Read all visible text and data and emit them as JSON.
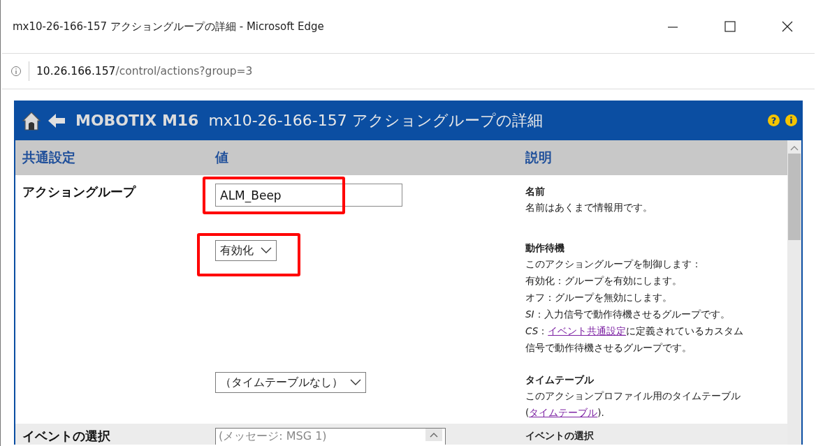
{
  "window": {
    "title": "mx10-26-166-157 アクショングループの詳細 - Microsoft Edge"
  },
  "address_bar": {
    "host": "10.26.166.157",
    "path": "/control/actions?group=3"
  },
  "header": {
    "brand": "MOBOTIX M16",
    "title": "mx10-26-166-157 アクショングループの詳細",
    "help": "?",
    "info": "i"
  },
  "columns": [
    "共通設定",
    "値",
    "説明"
  ],
  "sections": [
    {
      "label": "アクショングループ",
      "fields": [
        {
          "kind": "text",
          "value": "ALM_Beep",
          "highlighted": true,
          "description": {
            "title": "名前",
            "lines": [
              [
                {
                  "kind": "text",
                  "text": "名前はあくまで情報用です。"
                }
              ]
            ]
          }
        },
        {
          "kind": "select",
          "value": "有効化",
          "highlighted": true,
          "description": {
            "title": "動作待機",
            "lines": [
              [
                {
                  "kind": "text",
                  "text": "このアクショングループを制御します："
                }
              ],
              [
                {
                  "kind": "text",
                  "text": "有効化：グループを有効にします。"
                }
              ],
              [
                {
                  "kind": "text",
                  "text": "オフ：グループを無効にします。"
                }
              ],
              [
                {
                  "kind": "italic",
                  "text": "SI"
                },
                {
                  "kind": "text",
                  "text": "：入力信号で動作待機させるグループです。"
                }
              ],
              [
                {
                  "kind": "italic",
                  "text": "CS"
                },
                {
                  "kind": "text",
                  "text": "："
                },
                {
                  "kind": "link",
                  "text": "イベント共通設定"
                },
                {
                  "kind": "text",
                  "text": "に定義されているカスタム"
                }
              ],
              [
                {
                  "kind": "text",
                  "text": "信号で動作待機させるグループです。"
                }
              ]
            ]
          }
        },
        {
          "kind": "select",
          "value": "（タイムテーブルなし）",
          "description": {
            "title": "タイムテーブル",
            "lines": [
              [
                {
                  "kind": "text",
                  "text": "このアクションプロファイル用のタイムテーブル"
                }
              ],
              [
                {
                  "kind": "text",
                  "text": "("
                },
                {
                  "kind": "link",
                  "text": "タイムテーブル"
                },
                {
                  "kind": "text",
                  "text": ")."
                }
              ]
            ]
          }
        }
      ]
    },
    {
      "label": "イベントの選択",
      "shaded": true,
      "fields": [
        {
          "kind": "listbox",
          "value": "(メッセージ: MSG 1)",
          "description": {
            "title": "イベントの選択"
          }
        }
      ]
    }
  ]
}
